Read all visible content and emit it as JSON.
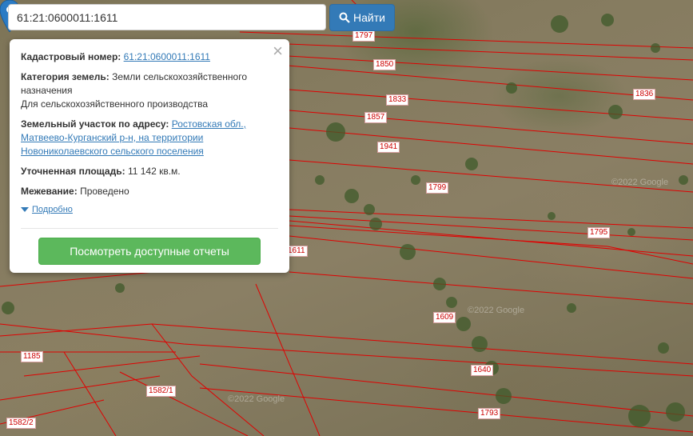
{
  "search": {
    "value": "61:21:0600011:1611",
    "button_label": "Найти"
  },
  "popup": {
    "cadastral_label": "Кадастровый номер:",
    "cadastral_value": "61:21:0600011:1611",
    "category_label": "Категория земель:",
    "category_value": "Земли сельскохозяйственного назначения",
    "category_usage": "Для сельскохозяйственного производства",
    "address_label": "Земельный участок по адресу:",
    "address_value": "Ростовская обл., Матвеево-Курганский р-н, на территории Новониколаевского сельского поселения",
    "area_label": "Уточненная площадь:",
    "area_value": "11 142 кв.м.",
    "survey_label": "Межевание:",
    "survey_value": "Проведено",
    "details_link": "Подробно",
    "report_button": "Посмотреть доступные отчеты",
    "close": "×"
  },
  "parcels": [
    {
      "id": "1797"
    },
    {
      "id": "1850"
    },
    {
      "id": "1836"
    },
    {
      "id": "1833"
    },
    {
      "id": "1857"
    },
    {
      "id": "1941"
    },
    {
      "id": "1799"
    },
    {
      "id": "1795"
    },
    {
      "id": "1611"
    },
    {
      "id": "1609"
    },
    {
      "id": "1640"
    },
    {
      "id": "1793"
    },
    {
      "id": "1185"
    },
    {
      "id": "1582/1"
    },
    {
      "id": "1582/2"
    }
  ],
  "watermarks": [
    "©2022 Google",
    "©2022 Google",
    "©2022 Google"
  ],
  "colors": {
    "parcel_line": "#e00000",
    "search_button": "#337ab7",
    "report_button": "#5cb85c",
    "marker": "#2b7bc4"
  }
}
